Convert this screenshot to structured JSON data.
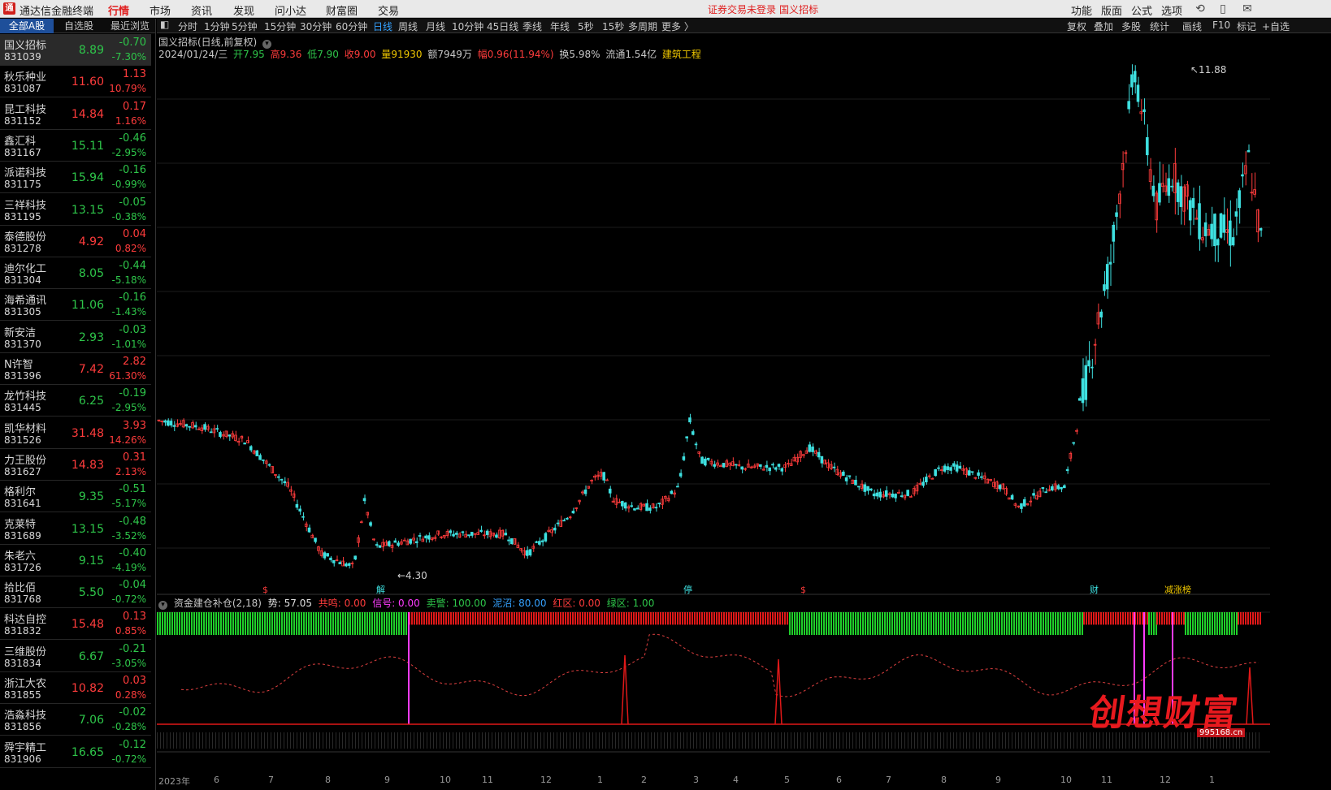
{
  "menubar": {
    "app_title": "通达信金融终端",
    "menus": [
      "行情",
      "市场",
      "资讯",
      "发现",
      "问小达",
      "财富圈",
      "交易"
    ],
    "active_menu": "行情",
    "notice": "证券交易未登录",
    "current_stock": "国义招标",
    "right_menus": [
      "功能",
      "版面",
      "公式",
      "选项"
    ]
  },
  "left_tabs": [
    "全部A股",
    "自选股",
    "最近浏览"
  ],
  "stocks": [
    {
      "name": "国义招标",
      "code": "831039",
      "price": "8.89",
      "chg": "-0.70",
      "pct": "-7.30%",
      "dir": "down"
    },
    {
      "name": "秋乐种业",
      "code": "831087",
      "price": "11.60",
      "chg": "1.13",
      "pct": "10.79%",
      "dir": "up"
    },
    {
      "name": "昆工科技",
      "code": "831152",
      "price": "14.84",
      "chg": "0.17",
      "pct": "1.16%",
      "dir": "up"
    },
    {
      "name": "鑫汇科",
      "code": "831167",
      "price": "15.11",
      "chg": "-0.46",
      "pct": "-2.95%",
      "dir": "down"
    },
    {
      "name": "派诺科技",
      "code": "831175",
      "price": "15.94",
      "chg": "-0.16",
      "pct": "-0.99%",
      "dir": "down"
    },
    {
      "name": "三祥科技",
      "code": "831195",
      "price": "13.15",
      "chg": "-0.05",
      "pct": "-0.38%",
      "dir": "down"
    },
    {
      "name": "泰德股份",
      "code": "831278",
      "price": "4.92",
      "chg": "0.04",
      "pct": "0.82%",
      "dir": "up"
    },
    {
      "name": "迪尔化工",
      "code": "831304",
      "price": "8.05",
      "chg": "-0.44",
      "pct": "-5.18%",
      "dir": "down"
    },
    {
      "name": "海希通讯",
      "code": "831305",
      "price": "11.06",
      "chg": "-0.16",
      "pct": "-1.43%",
      "dir": "down"
    },
    {
      "name": "新安洁",
      "code": "831370",
      "price": "2.93",
      "chg": "-0.03",
      "pct": "-1.01%",
      "dir": "down"
    },
    {
      "name": "N许智",
      "code": "831396",
      "price": "7.42",
      "chg": "2.82",
      "pct": "61.30%",
      "dir": "up"
    },
    {
      "name": "龙竹科技",
      "code": "831445",
      "price": "6.25",
      "chg": "-0.19",
      "pct": "-2.95%",
      "dir": "down"
    },
    {
      "name": "凯华材料",
      "code": "831526",
      "price": "31.48",
      "chg": "3.93",
      "pct": "14.26%",
      "dir": "up"
    },
    {
      "name": "力王股份",
      "code": "831627",
      "price": "14.83",
      "chg": "0.31",
      "pct": "2.13%",
      "dir": "up"
    },
    {
      "name": "格利尔",
      "code": "831641",
      "price": "9.35",
      "chg": "-0.51",
      "pct": "-5.17%",
      "dir": "down"
    },
    {
      "name": "克莱特",
      "code": "831689",
      "price": "13.15",
      "chg": "-0.48",
      "pct": "-3.52%",
      "dir": "down"
    },
    {
      "name": "朱老六",
      "code": "831726",
      "price": "9.15",
      "chg": "-0.40",
      "pct": "-4.19%",
      "dir": "down"
    },
    {
      "name": "拾比佰",
      "code": "831768",
      "price": "5.50",
      "chg": "-0.04",
      "pct": "-0.72%",
      "dir": "down"
    },
    {
      "name": "科达自控",
      "code": "831832",
      "price": "15.48",
      "chg": "0.13",
      "pct": "0.85%",
      "dir": "up"
    },
    {
      "name": "三维股份",
      "code": "831834",
      "price": "6.67",
      "chg": "-0.21",
      "pct": "-3.05%",
      "dir": "down"
    },
    {
      "name": "浙江大农",
      "code": "831855",
      "price": "10.82",
      "chg": "0.03",
      "pct": "0.28%",
      "dir": "up"
    },
    {
      "name": "浩淼科技",
      "code": "831856",
      "price": "7.06",
      "chg": "-0.02",
      "pct": "-0.28%",
      "dir": "down"
    },
    {
      "name": "舜宇精工",
      "code": "831906",
      "price": "16.65",
      "chg": "-0.12",
      "pct": "-0.72%",
      "dir": "down"
    }
  ],
  "periods": [
    "分时",
    "1分钟",
    "5分钟",
    "15分钟",
    "30分钟",
    "60分钟",
    "日线",
    "周线",
    "月线",
    "10分钟",
    "45日线",
    "季线",
    "年线",
    "5秒",
    "15秒",
    "多周期",
    "更多 〉"
  ],
  "active_period": "日线",
  "right_tools": [
    "复权",
    "叠加",
    "多股",
    "统计",
    "画线",
    "F10",
    "标记",
    "+自选"
  ],
  "chart": {
    "title": "国义招标(日线,前复权)",
    "date": "2024/01/24/三",
    "open_label": "开",
    "open": "7.95",
    "high_label": "高",
    "high": "9.36",
    "low_label": "低",
    "low": "7.90",
    "close_label": "收",
    "close": "9.00",
    "vol_label": "量",
    "volume": "91930",
    "amt_label": "额",
    "amount": "7949万",
    "amp_label": "幅",
    "amp": "0.96(11.94%)",
    "turnover": "换5.98%",
    "float_cap": "流通1.54亿",
    "sector": "建筑工程",
    "max_label": "11.88",
    "min_label": "4.30",
    "markers": [
      "$",
      "解",
      "停",
      "$",
      "财",
      "减涨榜"
    ]
  },
  "indicator": {
    "name": "资金建仓补仓(2,18)",
    "shi": "势: 57.05",
    "gongming": "共鸣: 0.00",
    "xinhao": "信号: 0.00",
    "maijing": "卖警: 100.00",
    "nizhao": "泥沼: 80.00",
    "hongqu": "红区: 0.00",
    "lvqu": "绿区: 1.00"
  },
  "x_axis": [
    "2023年",
    "6",
    "7",
    "8",
    "9",
    "10",
    "11",
    "12",
    "1",
    "2",
    "3",
    "4",
    "5",
    "6",
    "7",
    "8",
    "9",
    "10",
    "11",
    "12",
    "1"
  ],
  "watermark": {
    "text": "创想财富",
    "url": "995168.cn"
  },
  "colors": {
    "up": "#ff3c3c",
    "down": "#2ec64a",
    "accent": "#35a2ff",
    "signal": "#ff3cff"
  }
}
